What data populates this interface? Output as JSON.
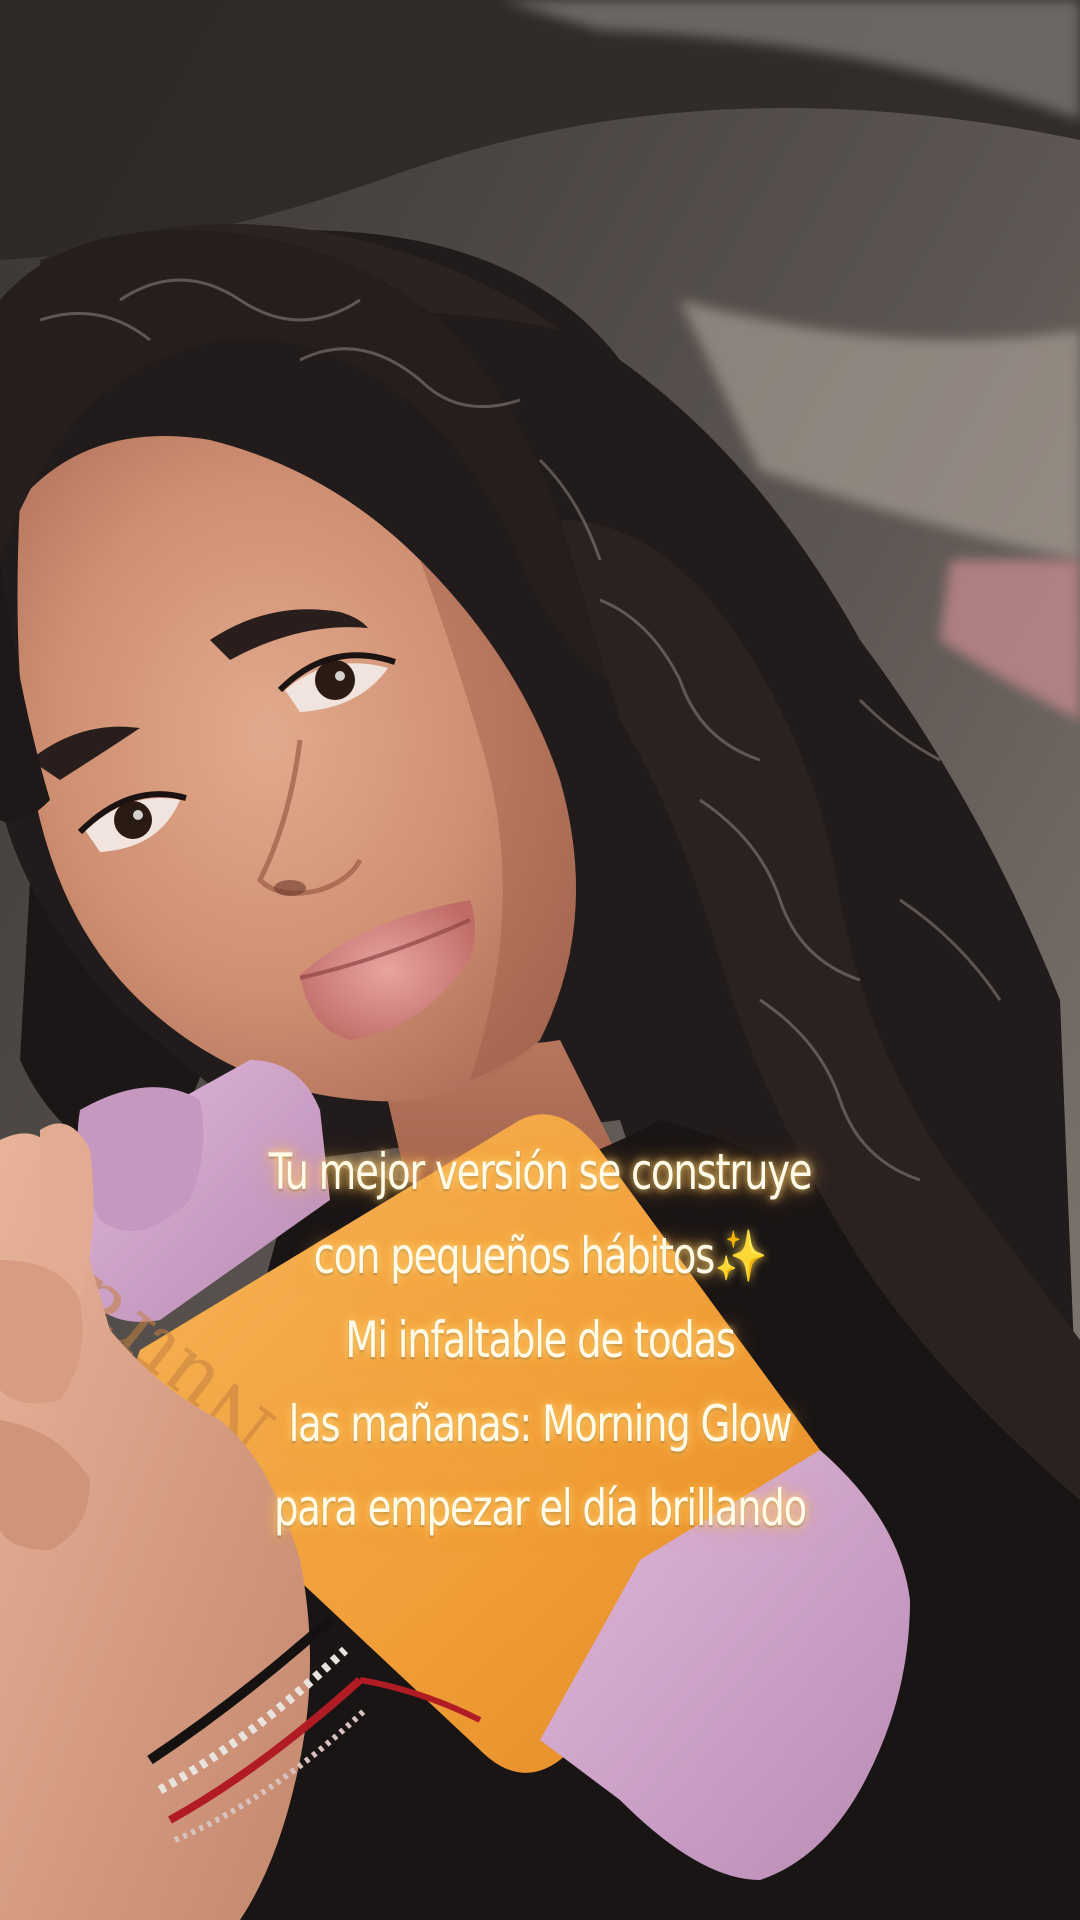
{
  "story": {
    "caption": {
      "line1": "Tu mejor versión se construye",
      "line2": "con pequeños hábitos",
      "line2_emoji": "✨",
      "line3": "Mi infaltable de todas",
      "line4": "las mañanas: Morning Glow",
      "line5": "para empezar el día brillando"
    },
    "bottle": {
      "brand_mark": "Nutrafruna"
    }
  },
  "colors": {
    "bottle_orange": "#f2a13c",
    "bottle_lilac": "#cfa0c8",
    "caption_glow": "#ffc864",
    "hair": "#211a1a"
  }
}
